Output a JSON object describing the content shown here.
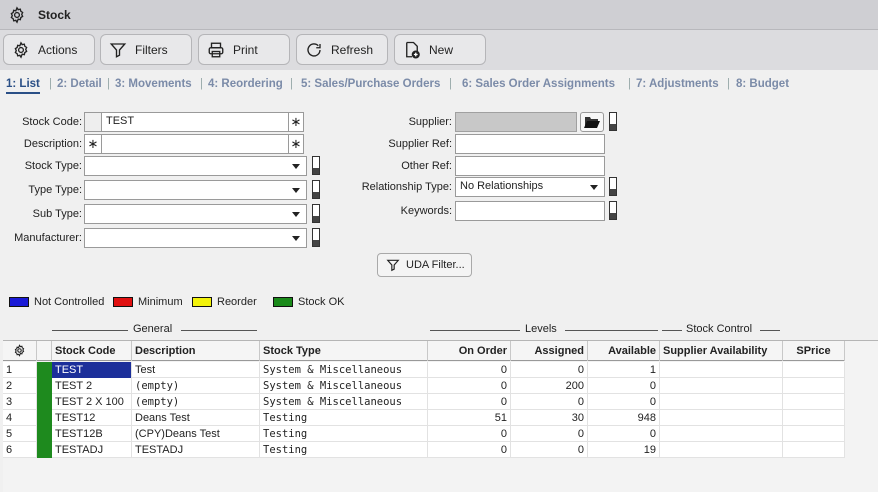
{
  "window": {
    "title": "Stock"
  },
  "toolbar": {
    "actions": "Actions",
    "filters": "Filters",
    "print": "Print",
    "refresh": "Refresh",
    "new": "New"
  },
  "tabs": [
    "1: List",
    "2: Detail",
    "3: Movements",
    "4: Reordering",
    "5: Sales/Purchase Orders",
    "6: Sales Order Assignments",
    "7: Adjustments",
    "8: Budget"
  ],
  "form": {
    "stock_code_label": "Stock Code:",
    "stock_code_value": "TEST",
    "description_label": "Description:",
    "description_value": "",
    "stock_type_label": "Stock Type:",
    "type_type_label": "Type Type:",
    "sub_type_label": "Sub Type:",
    "manufacturer_label": "Manufacturer:",
    "supplier_label": "Supplier:",
    "supplier_ref_label": "Supplier Ref:",
    "other_ref_label": "Other Ref:",
    "relationship_type_label": "Relationship Type:",
    "relationship_type_value": "No Relationships",
    "keywords_label": "Keywords:",
    "star_glyph": "∗",
    "uda_filter": "UDA Filter..."
  },
  "legend": [
    {
      "label": "Not Controlled",
      "color": "#1a1ad6"
    },
    {
      "label": "Minimum",
      "color": "#e01010"
    },
    {
      "label": "Reorder",
      "color": "#f2f20a"
    },
    {
      "label": "Stock OK",
      "color": "#1a8a1a"
    }
  ],
  "groups": {
    "general": "General",
    "levels": "Levels",
    "stock_control": "Stock Control"
  },
  "columns": {
    "stock_code": "Stock Code",
    "description": "Description",
    "stock_type": "Stock Type",
    "on_order": "On Order",
    "assigned": "Assigned",
    "available": "Available",
    "supplier_availability": "Supplier Availability",
    "sprice": "SPrice"
  },
  "rows": [
    {
      "n": "1",
      "code": "TEST",
      "desc": "Test",
      "type": "System & Miscellaneous",
      "on_order": "0",
      "assigned": "0",
      "available": "1"
    },
    {
      "n": "2",
      "code": "TEST 2",
      "desc": "(empty)",
      "type": "System & Miscellaneous",
      "on_order": "0",
      "assigned": "200",
      "available": "0"
    },
    {
      "n": "3",
      "code": "TEST 2 X 100",
      "desc": "(empty)",
      "type": "System & Miscellaneous",
      "on_order": "0",
      "assigned": "0",
      "available": "0"
    },
    {
      "n": "4",
      "code": "TEST12",
      "desc": "Deans Test",
      "type": "Testing",
      "on_order": "51",
      "assigned": "30",
      "available": "948"
    },
    {
      "n": "5",
      "code": "TEST12B",
      "desc": "(CPY)Deans Test",
      "type": "Testing",
      "on_order": "0",
      "assigned": "0",
      "available": "0"
    },
    {
      "n": "6",
      "code": "TESTADJ",
      "desc": "TESTADJ",
      "type": "Testing",
      "on_order": "0",
      "assigned": "0",
      "available": "19"
    }
  ]
}
